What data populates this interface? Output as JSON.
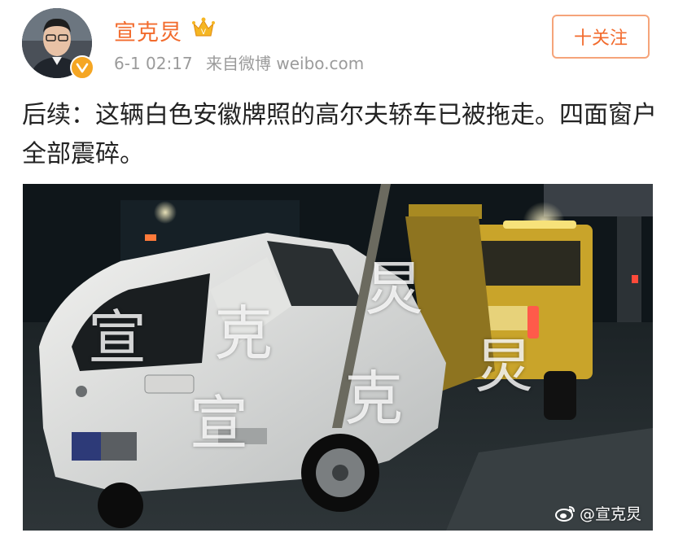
{
  "user": {
    "name": "宣克炅",
    "time": "6-1 02:17",
    "source": "来自微博 weibo.com"
  },
  "follow_button": "十关注",
  "post": {
    "text": "后续：这辆白色安徽牌照的高尔夫轿车已被拖走。四面窗户全部震碎。"
  },
  "image": {
    "watermark_chars": [
      "宣",
      "克",
      "炅",
      "宣",
      "克",
      "炅"
    ],
    "credit": "@宣克炅"
  },
  "colors": {
    "accent": "#f26b2d",
    "badge": "#f5a623",
    "meta_gray": "#9b9b9b"
  },
  "icons": [
    "vip-crown-icon",
    "verified-v-icon",
    "weibo-logo-icon"
  ]
}
